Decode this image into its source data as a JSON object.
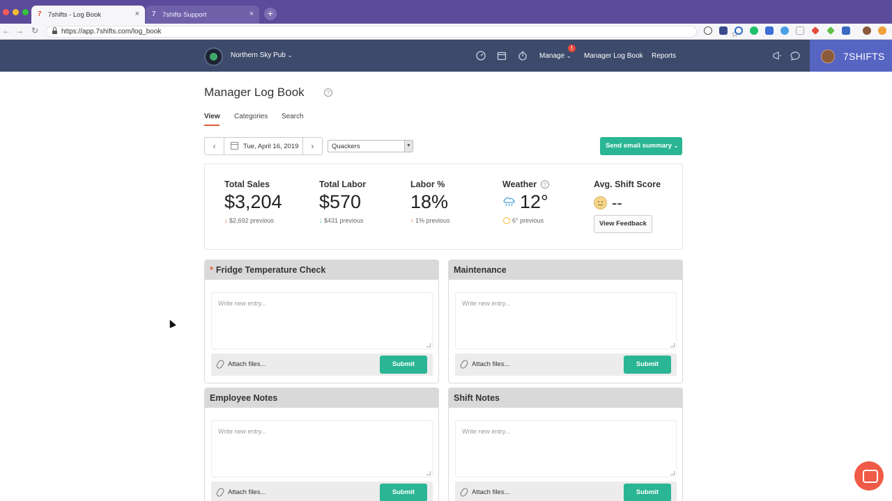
{
  "browser": {
    "tabs": [
      {
        "title": "7shifts - Log Book",
        "active": true
      },
      {
        "title": "7shifts Support",
        "active": false
      }
    ],
    "url": "https://app.7shifts.com/log_book"
  },
  "header": {
    "location_name": "Northern Sky Pub",
    "manage_label": "Manage",
    "manage_badge": "!",
    "log_book_label": "Manager Log Book",
    "reports_label": "Reports",
    "brand": "7SHIFTS"
  },
  "page": {
    "title": "Manager Log Book",
    "tabs": {
      "view": "View",
      "categories": "Categories",
      "search": "Search"
    },
    "date": "Tue, April 16, 2019",
    "location_select": "Quackers",
    "send_email_label": "Send email summary"
  },
  "stats": {
    "total_sales": {
      "label": "Total Sales",
      "value": "$3,204",
      "previous": "$2,692 previous"
    },
    "total_labor": {
      "label": "Total Labor",
      "value": "$570",
      "previous": "$431 previous"
    },
    "labor_pct": {
      "label": "Labor %",
      "value": "18%",
      "previous": "1% previous"
    },
    "weather": {
      "label": "Weather",
      "value": "12°",
      "previous": "6° previous"
    },
    "shift_score": {
      "label": "Avg. Shift Score",
      "value": "--",
      "feedback_label": "View Feedback"
    }
  },
  "categories": [
    {
      "title": "Fridge Temperature Check",
      "required_mark": "*",
      "placeholder": "Write new entry...",
      "attach_label": "Attach files...",
      "submit_label": "Submit"
    },
    {
      "title": "Maintenance",
      "placeholder": "Write new entry...",
      "attach_label": "Attach files...",
      "submit_label": "Submit"
    },
    {
      "title": "Employee Notes",
      "placeholder": "Write new entry...",
      "attach_label": "Attach files...",
      "submit_label": "Submit"
    },
    {
      "title": "Shift Notes",
      "placeholder": "Write new entry...",
      "attach_label": "Attach files...",
      "submit_label": "Submit"
    }
  ],
  "colors": {
    "tabbar": "#5b4b9a",
    "appbar": "#3d4a6b",
    "accent_green": "#2ab594",
    "accent_red": "#e05a3b"
  }
}
